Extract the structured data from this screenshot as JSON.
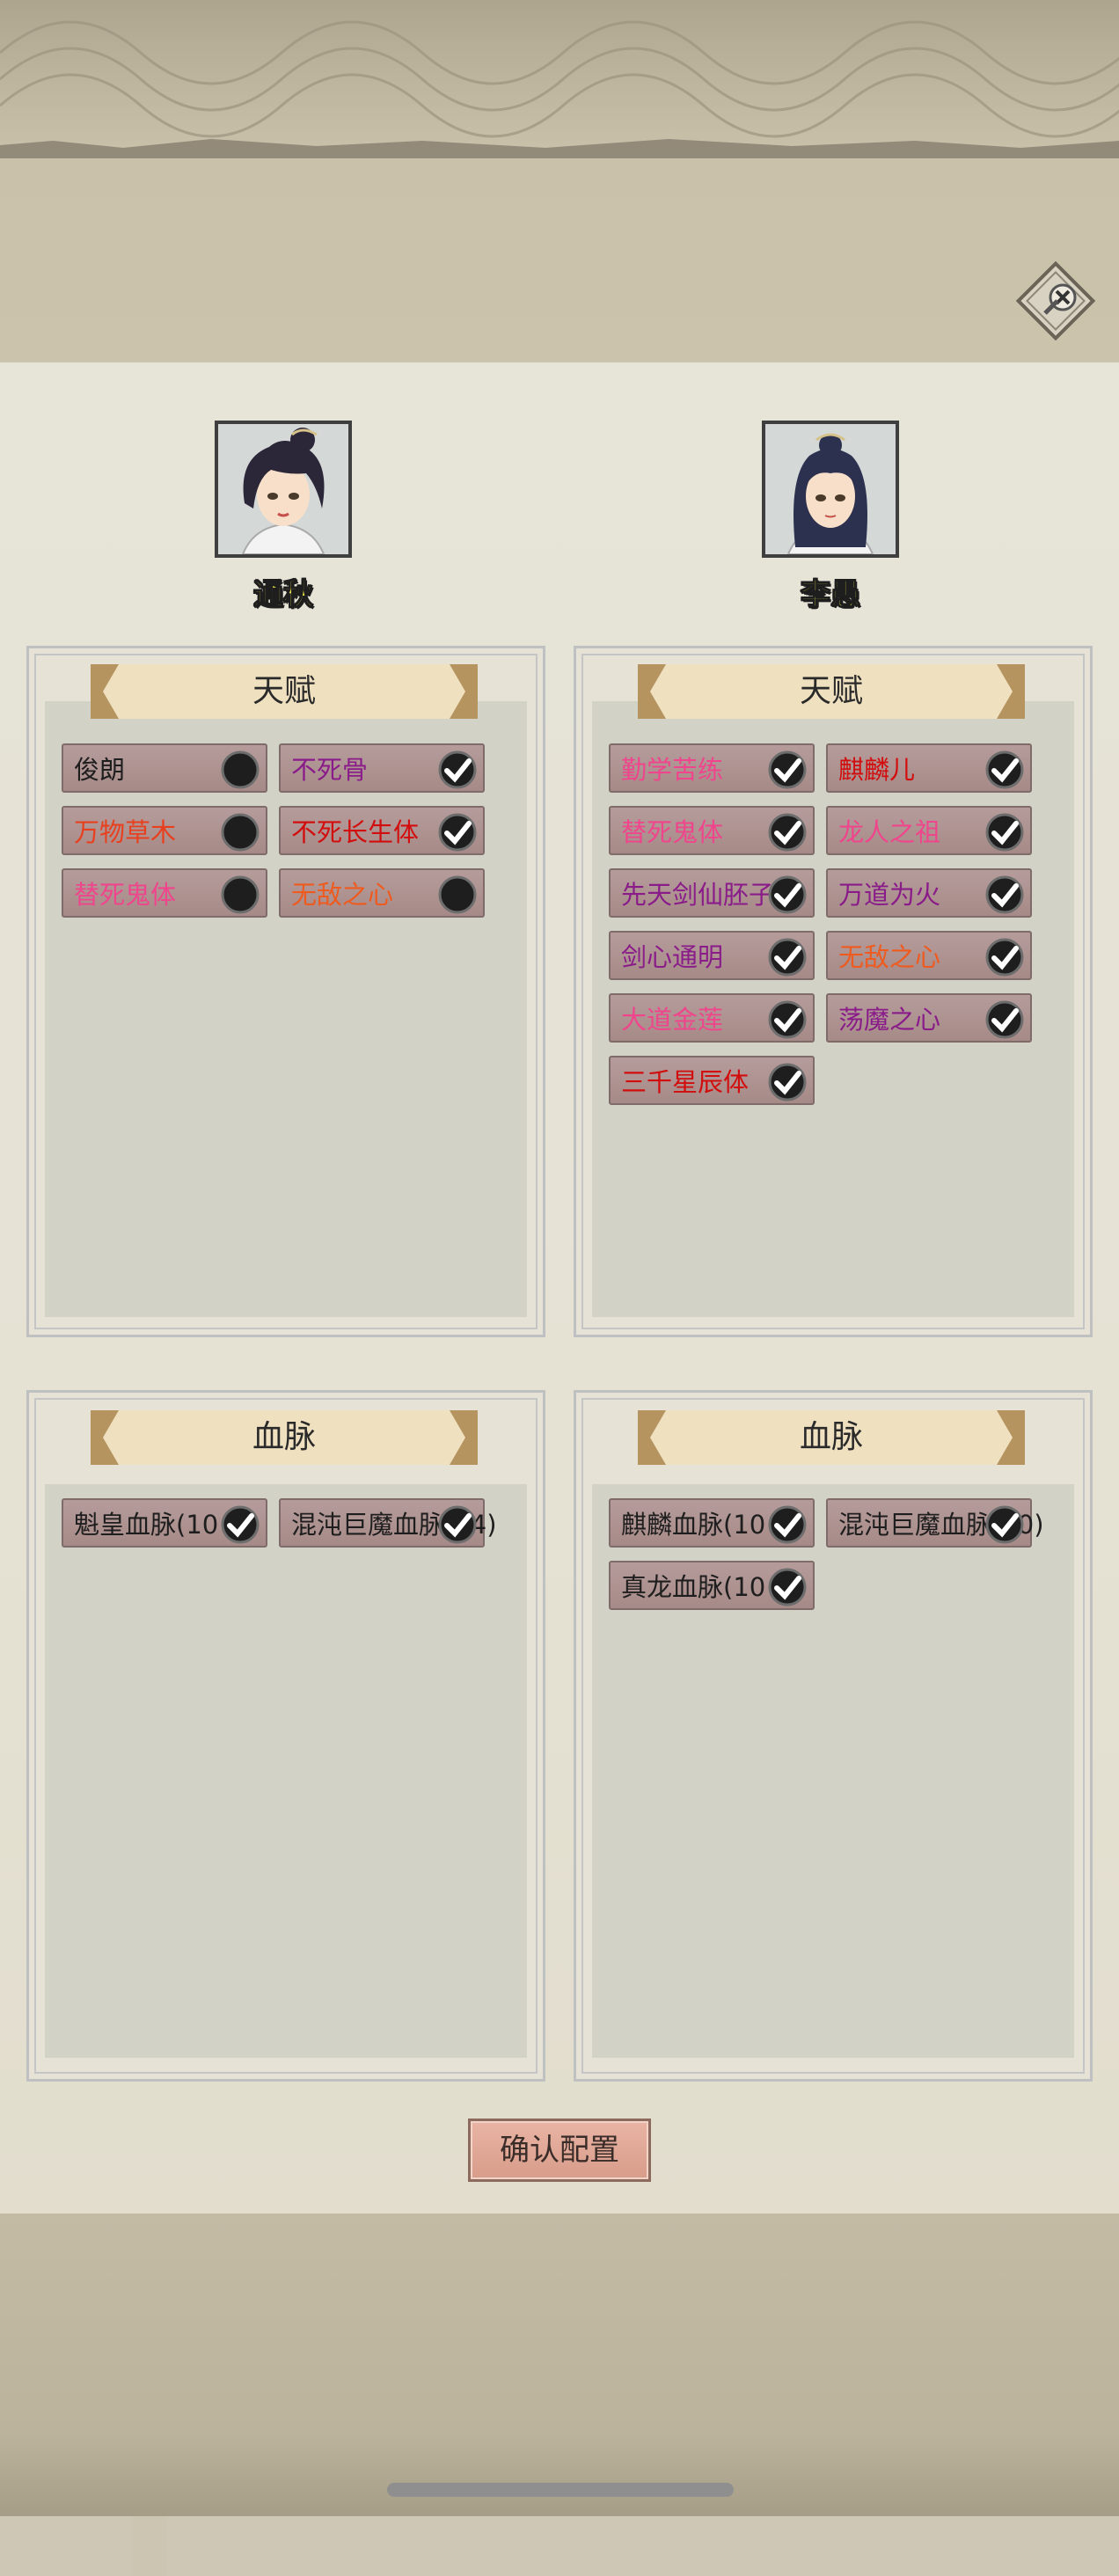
{
  "close_icon": "close-icon",
  "characters": [
    {
      "name": "通秋",
      "avatar": "avatar-portrait-bun-hair"
    },
    {
      "name": "李愚",
      "avatar": "avatar-portrait-long-hair"
    }
  ],
  "sections": {
    "talent_title": "天赋",
    "bloodline_title": "血脉"
  },
  "left_talents": [
    {
      "label": "俊朗",
      "color": "#1e1e1e",
      "selected": false
    },
    {
      "label": "不死骨",
      "color": "#8a1c8a",
      "selected": true
    },
    {
      "label": "万物草木",
      "color": "#e8401e",
      "selected": false
    },
    {
      "label": "不死长生体",
      "color": "#d20d0d",
      "selected": true
    },
    {
      "label": "替死鬼体",
      "color": "#f0458c",
      "selected": false
    },
    {
      "label": "无敌之心",
      "color": "#ef5a1e",
      "selected": false
    }
  ],
  "right_talents": [
    {
      "label": "勤学苦练",
      "color": "#f0458c",
      "selected": true
    },
    {
      "label": "麒麟儿",
      "color": "#d20d0d",
      "selected": true
    },
    {
      "label": "替死鬼体",
      "color": "#f0458c",
      "selected": true
    },
    {
      "label": "龙人之祖",
      "color": "#f0458c",
      "selected": true
    },
    {
      "label": "先天剑仙胚子",
      "color": "#8a1c8a",
      "selected": true
    },
    {
      "label": "万道为火",
      "color": "#8a1c8a",
      "selected": true
    },
    {
      "label": "剑心通明",
      "color": "#8a1c8a",
      "selected": true
    },
    {
      "label": "无敌之心",
      "color": "#ef5a1e",
      "selected": true
    },
    {
      "label": "大道金莲",
      "color": "#f0458c",
      "selected": true
    },
    {
      "label": "荡魔之心",
      "color": "#8a1c8a",
      "selected": true
    },
    {
      "label": "三千星辰体",
      "color": "#d20d0d",
      "selected": true
    }
  ],
  "left_bloodlines": [
    {
      "label": "魁皇血脉(10",
      "color": "#1e1e1e",
      "selected": true
    },
    {
      "label": "混沌巨魔血脉(34)",
      "color": "#1e1e1e",
      "selected": true
    }
  ],
  "right_bloodlines": [
    {
      "label": "麒麟血脉(10",
      "color": "#1e1e1e",
      "selected": true
    },
    {
      "label": "混沌巨魔血脉(10)",
      "color": "#1e1e1e",
      "selected": true
    },
    {
      "label": "真龙血脉(10",
      "color": "#1e1e1e",
      "selected": true
    }
  ],
  "confirm_label": "确认配置",
  "colors": {
    "name_yellow": "#f7f04a",
    "tag_bg": "#b09694",
    "panel_bg": "#e6e3d6",
    "selected_mark": "#1e1e1e"
  }
}
